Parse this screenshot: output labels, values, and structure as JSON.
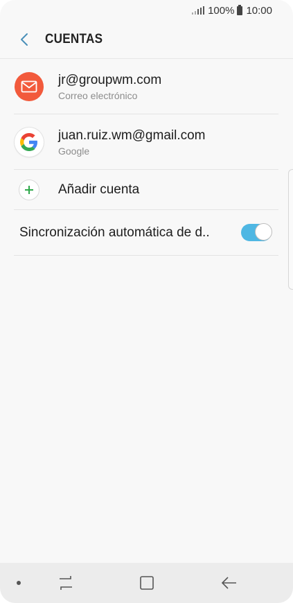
{
  "status_bar": {
    "battery_percent": "100%",
    "time": "10:00"
  },
  "header": {
    "back_icon": "chevron-left-icon",
    "title": "CUENTAS"
  },
  "accounts": [
    {
      "email": "jr@groupwm.com",
      "type": "Correo electrónico",
      "icon": "mail-icon",
      "icon_color": "#f25a3c"
    },
    {
      "email": "juan.ruiz.wm@gmail.com",
      "type": "Google",
      "icon": "google-icon"
    }
  ],
  "add_account": {
    "label": "Añadir cuenta",
    "icon": "plus-icon",
    "icon_color": "#2ea84a"
  },
  "auto_sync": {
    "label": "Sincronización automática de d..",
    "enabled": true,
    "accent": "#4fb7e3"
  },
  "nav_bar": {
    "buttons": [
      "recents-icon",
      "home-icon",
      "back-icon"
    ]
  }
}
